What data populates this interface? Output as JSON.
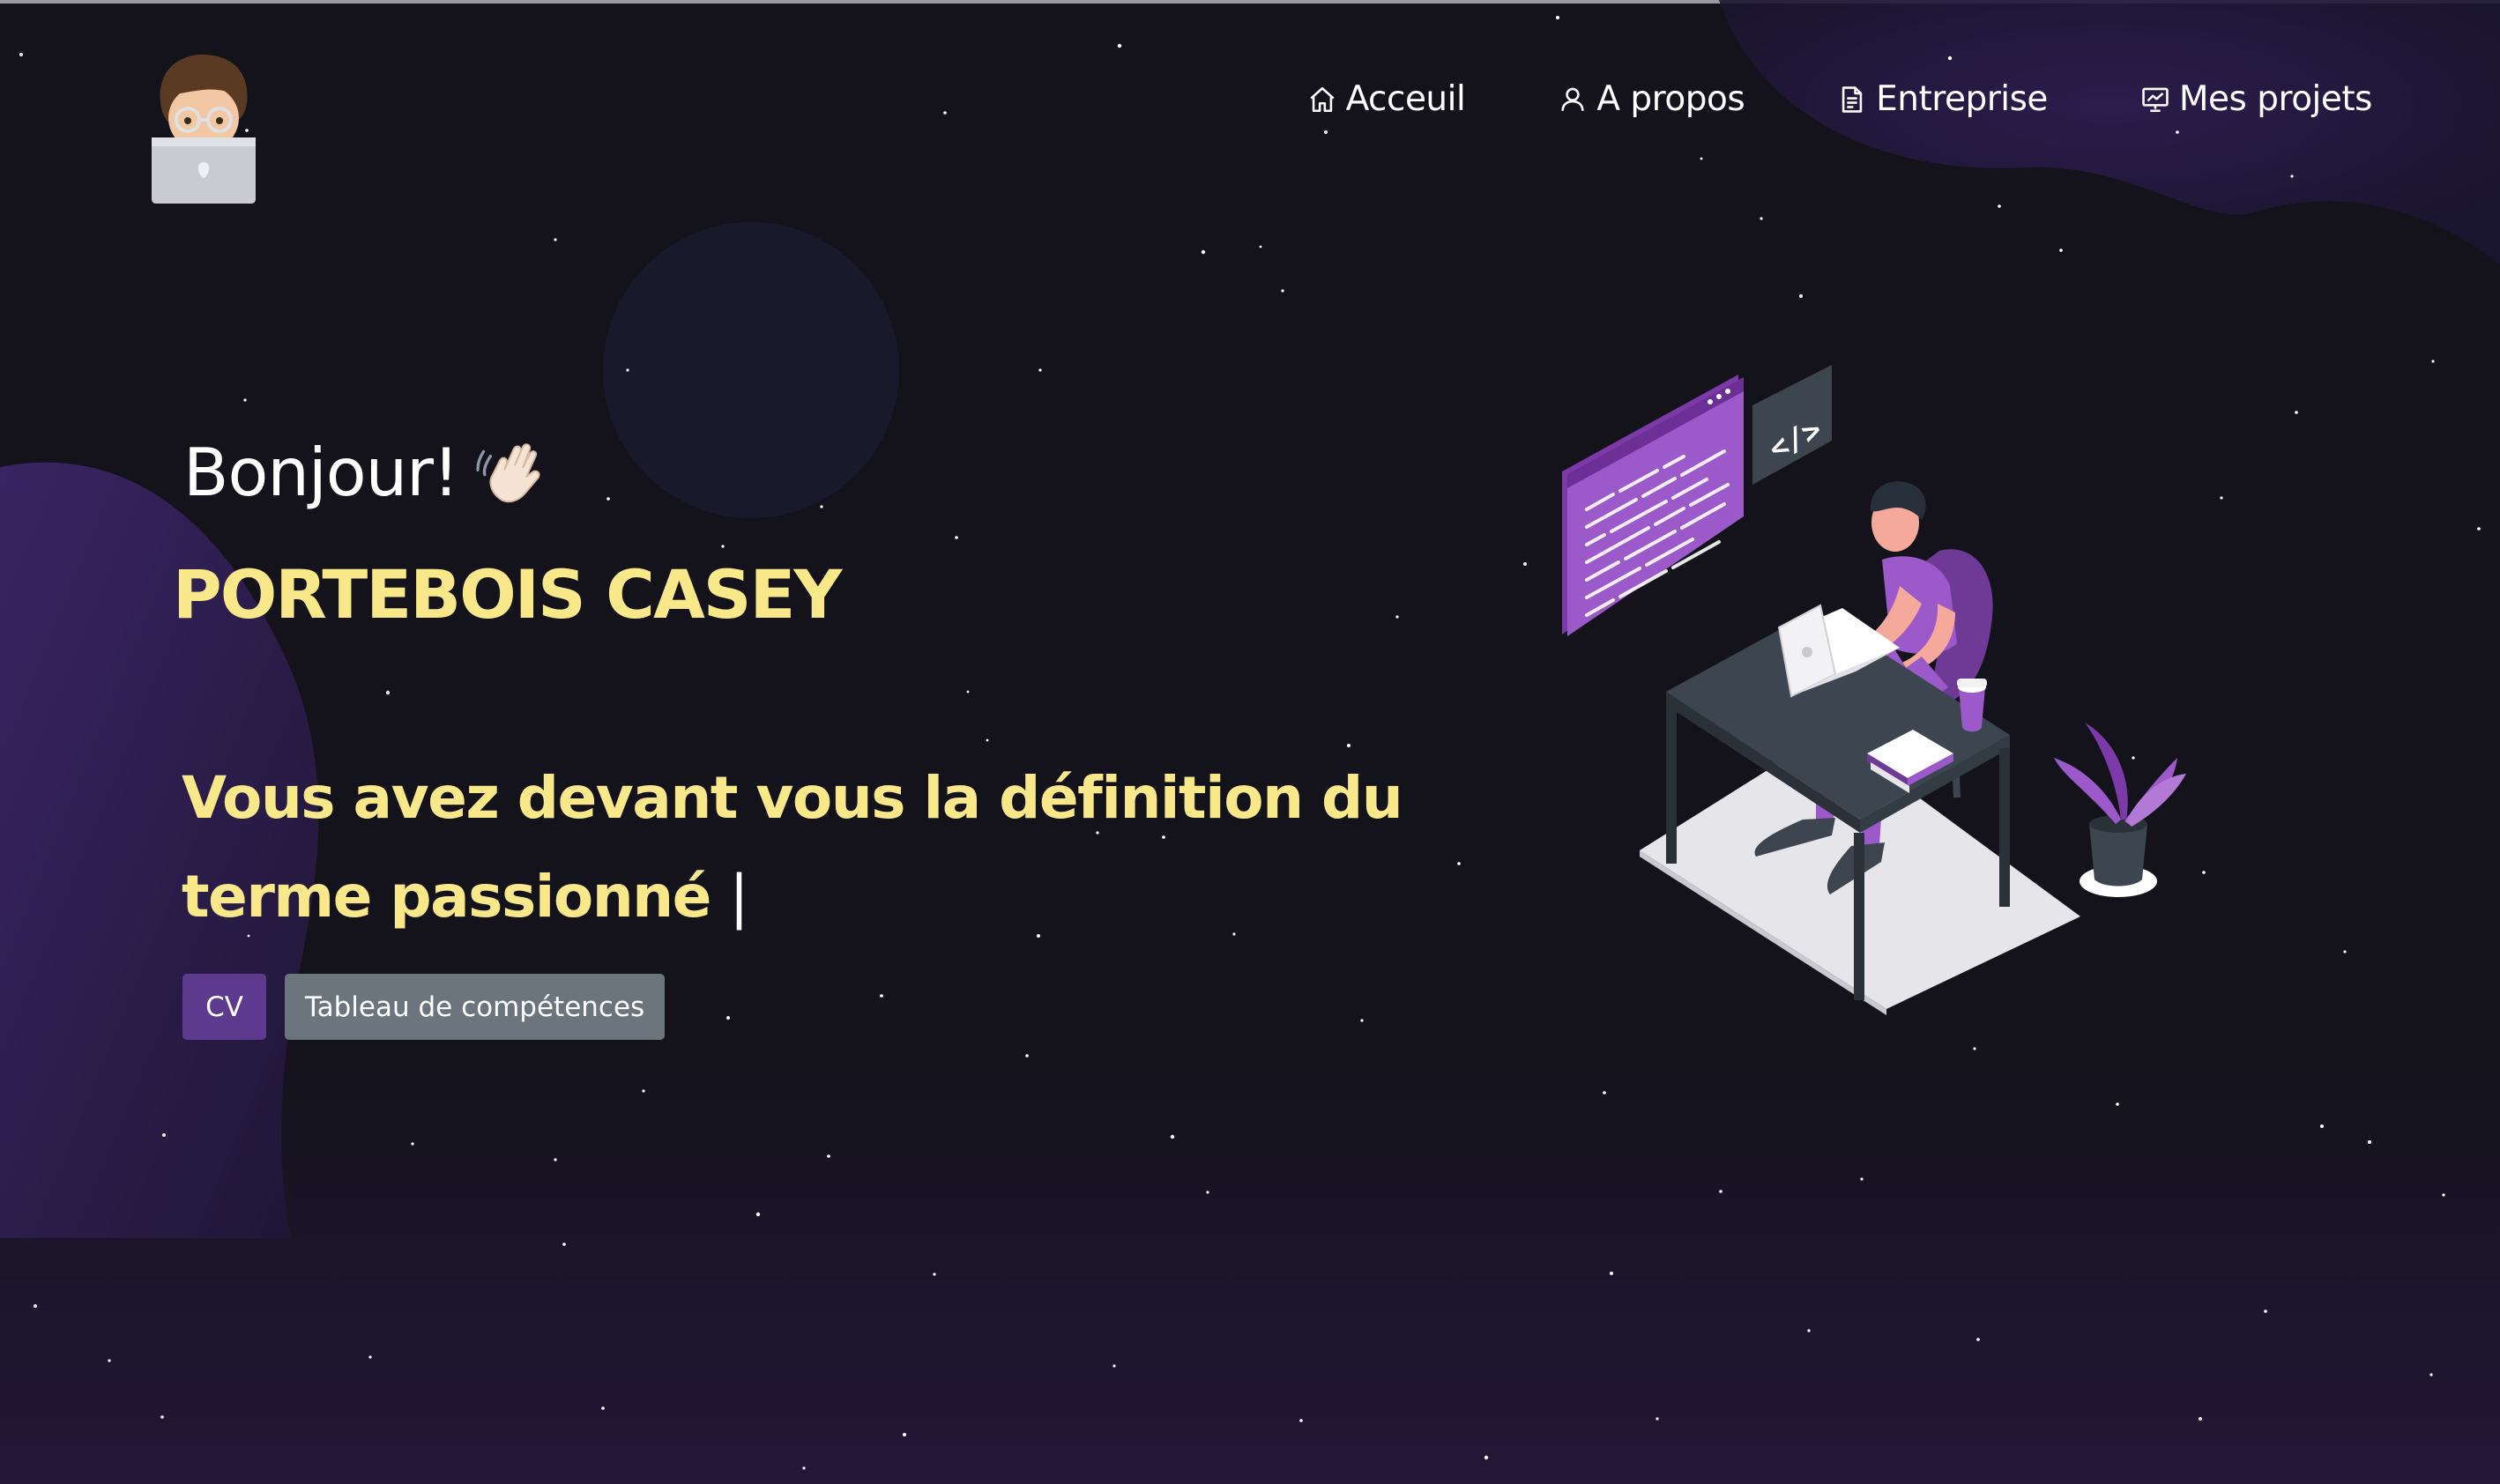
{
  "nav": {
    "items": [
      {
        "label": "Acceuil",
        "icon": "home-icon"
      },
      {
        "label": "A propos",
        "icon": "user-icon"
      },
      {
        "label": "Entreprise",
        "icon": "document-icon"
      },
      {
        "label": "Mes projets",
        "icon": "presentation-icon"
      }
    ]
  },
  "hero": {
    "greeting": "Bonjour!",
    "greeting_icon": "waving-hand-icon",
    "name": "PORTEBOIS CASEY",
    "tagline": "Vous avez devant vous la définition du terme passionné",
    "caret": "|",
    "buttons": {
      "cv": "CV",
      "skills": "Tableau de compétences"
    }
  },
  "colors": {
    "background": "#14131c",
    "blob": "#2a1a4a",
    "accent_text": "#f8e88a",
    "primary_button": "#5d3a8e",
    "secondary_button": "#6c757d",
    "illustration_purple": "#9b59c9"
  }
}
